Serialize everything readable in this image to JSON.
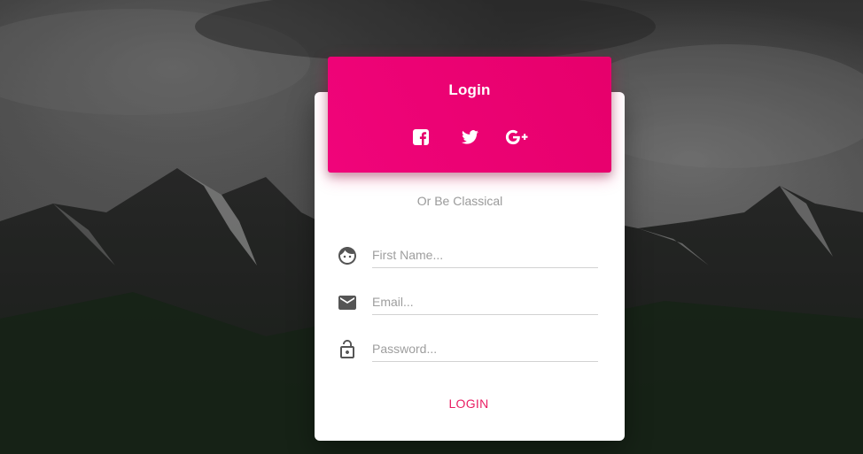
{
  "header": {
    "title": "Login",
    "social": [
      {
        "icon": "facebook-icon"
      },
      {
        "icon": "twitter-icon"
      },
      {
        "icon": "google-plus-icon"
      }
    ]
  },
  "subtitle": "Or Be Classical",
  "form": {
    "first_name": {
      "icon": "face-icon",
      "placeholder": "First Name...",
      "value": ""
    },
    "email": {
      "icon": "email-icon",
      "placeholder": "Email...",
      "value": ""
    },
    "password": {
      "icon": "lock-icon",
      "placeholder": "Password...",
      "value": ""
    }
  },
  "actions": {
    "login_label": "LOGIN"
  },
  "colors": {
    "accent": "#e91e63",
    "header_gradient_start": "#f0047a",
    "header_gradient_end": "#e6006b",
    "icon": "#555555"
  }
}
